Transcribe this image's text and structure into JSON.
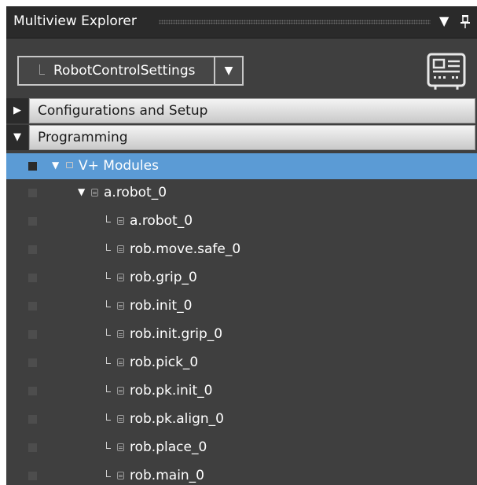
{
  "window": {
    "title": "Multiview Explorer",
    "dropdown_icon": "dropdown-arrow-icon",
    "pin_icon": "pin-icon"
  },
  "device_selector": {
    "value": "RobotControlSettings",
    "arrow": "▼",
    "controller_icon": "controller-device-icon"
  },
  "sections": [
    {
      "label": "Configurations and Setup",
      "toggle": "▶",
      "expanded": false
    },
    {
      "label": "Programming",
      "toggle": "▼",
      "expanded": true
    }
  ],
  "tree": {
    "root": {
      "label": "V+ Modules",
      "toggle": "▼",
      "selected": true
    },
    "module": {
      "label": "a.robot_0",
      "toggle": "▼"
    },
    "programs": [
      "a.robot_0",
      "rob.move.safe_0",
      "rob.grip_0",
      "rob.init_0",
      "rob.init.grip_0",
      "rob.pick_0",
      "rob.pk.init_0",
      "rob.pk.align_0",
      "rob.place_0",
      "rob.main_0"
    ]
  },
  "colors": {
    "panel_bg": "#3f3f3f",
    "title_bg": "#2a2a2a",
    "selection": "#5b9bd5",
    "section_bar": "#dcdcdc"
  }
}
